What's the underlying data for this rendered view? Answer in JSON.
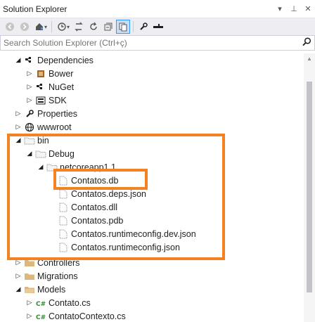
{
  "window": {
    "title": "Solution Explorer"
  },
  "title_buttons": {
    "dropdown": "▾",
    "pin": "⊥",
    "close": "✕"
  },
  "search": {
    "placeholder": "Search Solution Explorer (Ctrl+ç)"
  },
  "tree": [
    {
      "label": "Dependencies",
      "arrow": "◢",
      "icon": "dependencies-icon"
    },
    {
      "label": "Bower",
      "arrow": "▷",
      "icon": "bower-icon"
    },
    {
      "label": "NuGet",
      "arrow": "▷",
      "icon": "nuget-icon"
    },
    {
      "label": "SDK",
      "arrow": "▷",
      "icon": "sdk-icon"
    },
    {
      "label": "Properties",
      "arrow": "▷",
      "icon": "wrench-icon"
    },
    {
      "label": "wwwroot",
      "arrow": "▷",
      "icon": "globe-icon"
    },
    {
      "label": "bin",
      "arrow": "◢",
      "icon": "folder-icon"
    },
    {
      "label": "Debug",
      "arrow": "◢",
      "icon": "folder-icon"
    },
    {
      "label": "netcoreapp1.1",
      "arrow": "◢",
      "icon": "folder-icon"
    },
    {
      "label": "Contatos.db",
      "arrow": "",
      "icon": "file-icon"
    },
    {
      "label": "Contatos.deps.json",
      "arrow": "",
      "icon": "file-icon"
    },
    {
      "label": "Contatos.dll",
      "arrow": "",
      "icon": "file-icon"
    },
    {
      "label": "Contatos.pdb",
      "arrow": "",
      "icon": "file-icon"
    },
    {
      "label": "Contatos.runtimeconfig.dev.json",
      "arrow": "",
      "icon": "file-icon"
    },
    {
      "label": "Contatos.runtimeconfig.json",
      "arrow": "",
      "icon": "file-icon"
    },
    {
      "label": "Controllers",
      "arrow": "▷",
      "icon": "folder-icon"
    },
    {
      "label": "Migrations",
      "arrow": "▷",
      "icon": "folder-icon"
    },
    {
      "label": "Models",
      "arrow": "◢",
      "icon": "folder-icon"
    },
    {
      "label": "Contato.cs",
      "arrow": "▷",
      "icon": "csharp-icon"
    },
    {
      "label": "ContatoContexto.cs",
      "arrow": "▷",
      "icon": "csharp-icon"
    }
  ],
  "colors": {
    "highlight": "#f58220",
    "folder": "#dcb67a",
    "csharp": "#388a34"
  }
}
